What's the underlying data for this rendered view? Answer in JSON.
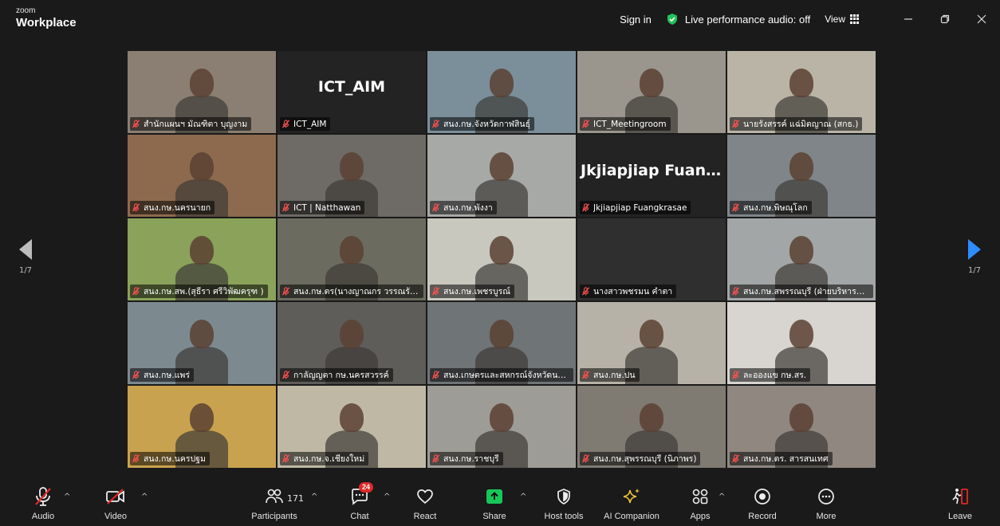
{
  "titlebar": {
    "brand_small": "zoom",
    "brand_big": "Workplace",
    "sign_in": "Sign in",
    "audio_status": "Live performance audio: off",
    "view_label": "View"
  },
  "colors": {
    "accent_blue": "#2d8cff",
    "active_border": "#23d160",
    "muted_red": "#e02828"
  },
  "pager": {
    "left_page": "1/7",
    "right_page": "1/7"
  },
  "tiles": [
    {
      "label": "สำนักแผนฯ มัณฑิตา บุญงาม",
      "big_name": "",
      "bg": "#8a7f72"
    },
    {
      "label": "ICT_AIM",
      "big_name": "ICT_AIM",
      "bg": "#232323"
    },
    {
      "label": "สนง.กษ.จังหวัดกาฬสินธุ์",
      "big_name": "",
      "bg": "#7b8f9a"
    },
    {
      "label": "ICT_Meetingroom",
      "big_name": "",
      "bg": "#9a968e"
    },
    {
      "label": "นายรังสรรค์ แฉ่มิตญาณ (สกธ.)",
      "big_name": "",
      "bg": "#b9b4a6"
    },
    {
      "label": "สนง.กษ.นครนายก",
      "big_name": "",
      "bg": "#8d6a4e"
    },
    {
      "label": "ICT | Natthawan",
      "big_name": "",
      "bg": "#6e6a66"
    },
    {
      "label": "สนง.กษ.พังงา",
      "big_name": "",
      "bg": "#a7a9a6"
    },
    {
      "label": "Jkjiapjiap Fuangkrasae",
      "big_name": "Jkjiapjiap  Fuan...",
      "bg": "#232323"
    },
    {
      "label": "สนง.กษ.พิษณุโลก",
      "big_name": "",
      "bg": "#7f8589"
    },
    {
      "label": "สนง.กษ.สพ.(สุธีรา ศรีวิพัฒครุฑ )",
      "big_name": "",
      "bg": "#8aa25a"
    },
    {
      "label": "สนง.กษ.ตร(นางญาณกร วรรณรัต...",
      "big_name": "",
      "bg": "#6b6c5f"
    },
    {
      "label": "สนง.กษ.เพชรบูรณ์",
      "big_name": "",
      "bg": "#c9c8bf"
    },
    {
      "label": "นางสาวพชรมน คำตา",
      "big_name": "",
      "bg": "#2f2f2f"
    },
    {
      "label": "สนง.กษ.สพรรณบุรี (ฝ่ายบริหารทั่...",
      "big_name": "",
      "bg": "#a3a6a6"
    },
    {
      "label": "สนง.กษ.แพร่",
      "big_name": "",
      "bg": "#7c8a90"
    },
    {
      "label": "กาลัญญตา กษ.นครสวรรค์",
      "big_name": "",
      "bg": "#5e5d5a"
    },
    {
      "label": "สนง.เกษตรและสหกรณ์จังหวัดนคร...",
      "big_name": "",
      "bg": "#6f7476"
    },
    {
      "label": "สนง.กษ.ปน",
      "big_name": "",
      "bg": "#b7b2a7"
    },
    {
      "label": "ละอองแข กษ.สร.",
      "big_name": "",
      "bg": "#d8d4cf"
    },
    {
      "label": "สนง.กษ.นครปฐม",
      "big_name": "",
      "bg": "#c9a24f"
    },
    {
      "label": "สนง.กษ.จ.เชียงใหม่",
      "big_name": "",
      "bg": "#bfb8a5"
    },
    {
      "label": "สนง.กษ.ราชบุรี",
      "big_name": "",
      "bg": "#9e9c96"
    },
    {
      "label": "สนง.กษ.สุพรรณบุรี (นิภาพร)",
      "big_name": "",
      "bg": "#7f7a72"
    },
    {
      "label": "สนง.กษ.ตร. สารสนเทศ",
      "big_name": "",
      "bg": "#8f8780"
    }
  ],
  "toolbar": {
    "audio": "Audio",
    "video": "Video",
    "participants": "Participants",
    "participants_count": "171",
    "chat": "Chat",
    "chat_badge": "24",
    "react": "React",
    "share": "Share",
    "host_tools": "Host tools",
    "ai_companion": "AI Companion",
    "apps": "Apps",
    "record": "Record",
    "more": "More",
    "leave": "Leave"
  }
}
